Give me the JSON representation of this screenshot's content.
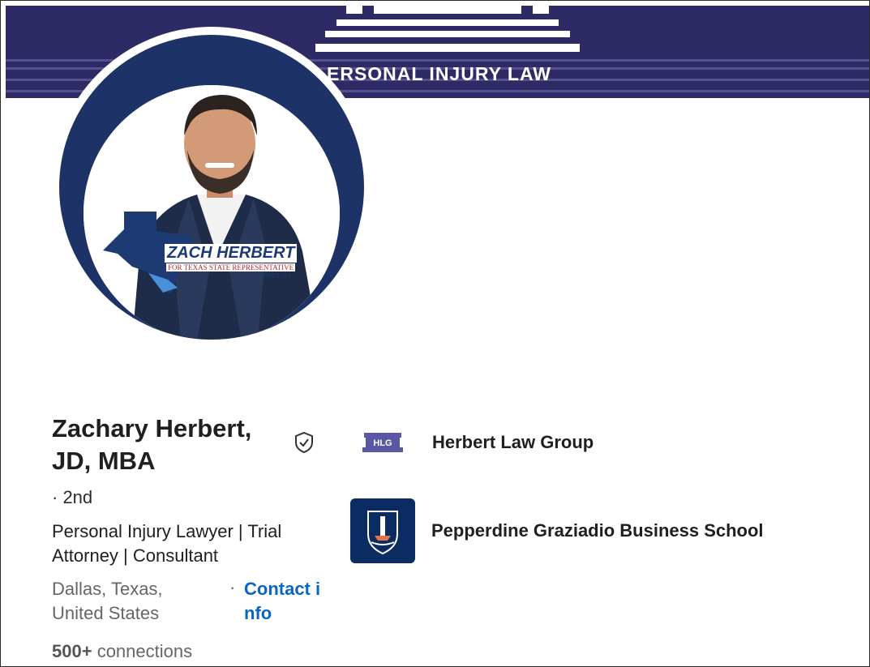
{
  "banner": {
    "text": "ERSONAL INJURY LAW"
  },
  "avatar": {
    "badge_name": "ZACH HERBERT",
    "badge_sub": "FOR TEXAS STATE REPRESENTATIVE",
    "badge_district": "DISTRICT 112"
  },
  "profile": {
    "name": "Zachary Herbert, JD, MBA",
    "degree": "· 2nd",
    "headline": "Personal Injury Lawyer | Trial Attorney | Consultant",
    "location": "Dallas, Texas, United States",
    "contact_sep": "·",
    "contact_label": "Contact info",
    "connections_count": "500+",
    "connections_label": "connections"
  },
  "organizations": [
    {
      "name": "Herbert Law Group",
      "logo_text": "HLG"
    },
    {
      "name": "Pepperdine Graziadio Business School"
    }
  ],
  "colors": {
    "banner_bg": "#2d2a66",
    "avatar_ring": "#1d3266",
    "link": "#0a66c2",
    "pepperdine_bg": "#0b2c63"
  }
}
